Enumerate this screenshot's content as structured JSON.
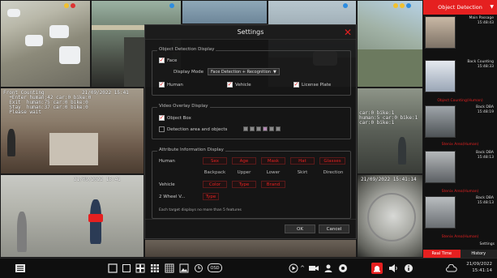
{
  "cameras": [
    {
      "id": "cam1",
      "timestamp": "",
      "overlay": "",
      "dots": []
    },
    {
      "id": "cam2",
      "timestamp": "",
      "overlay": "",
      "dots": []
    },
    {
      "id": "cam3",
      "timestamp": "",
      "overlay": "",
      "dots": []
    },
    {
      "id": "cam4",
      "timestamp": "",
      "overlay": "",
      "dots": []
    },
    {
      "id": "cam5",
      "timestamp": "",
      "overlay": "",
      "dots": []
    },
    {
      "id": "cam6",
      "timestamp": "",
      "overlay": "",
      "dots": []
    }
  ],
  "cam_overlays": {
    "cam1_ts": "",
    "cam6_ts": "Front Counting",
    "cam6_text": "  +Enter human:42 car:0 bike:0\n  Exit  human:75 car:0 bike:0\n  Stay  human:37 car:0 bike:0\n  Please wait",
    "cam6_date": "21/09/2022 15:41",
    "cam7_text": "car:0 bike:1\nhuman:5 car:0 bike:1\ncar:0 bike:1",
    "cam8_date": "21/09/2022 15:41",
    "cam10_date": "21/09/2022 15:41:14"
  },
  "right_panel": {
    "header": "Object Detection",
    "detections": [
      {
        "title": "Main Passage",
        "time": "15:48:43",
        "label": ""
      },
      {
        "title": "Back Counting",
        "time": "15:48:33",
        "label": "Object Counting(Human)"
      },
      {
        "title": "Back DBA",
        "time": "15:48:19",
        "label": "Stenix Area(Human)"
      },
      {
        "title": "Back DBA",
        "time": "15:48:13",
        "label": "Stenix Area(Human)"
      },
      {
        "title": "Back DBA",
        "time": "15:48:13",
        "label": "Stenix Area(Human)"
      }
    ],
    "settings_label": "Settings",
    "tab_realtime": "Real Time",
    "tab_history": "History"
  },
  "dialog": {
    "title": "Settings",
    "object_detection": {
      "section_title": "Object Detection Display",
      "face_label": "Face",
      "display_mode_label": "Display Mode",
      "display_mode_value": "Face Detection + Recognition",
      "human_label": "Human",
      "vehicle_label": "Vehicle",
      "plate_label": "License Plate"
    },
    "video_overlay": {
      "section_title": "Video Overlay Display",
      "object_box_label": "Object Box",
      "detection_area_label": "Detection area and objects",
      "swatch_colors": [
        "#8a8a8a",
        "#8a8a8a",
        "#8a8a8a",
        "#b48ab4",
        "#8a8a8a",
        "#8a8a8a"
      ]
    },
    "attribute": {
      "section_title": "Attribute Information Display",
      "human_label": "Human",
      "human_row1": [
        "Sex",
        "Age",
        "Mask",
        "Hat",
        "Glasses"
      ],
      "human_row2": [
        "Backpack",
        "Upper",
        "Lower",
        "Skirt",
        "Direction"
      ],
      "vehicle_label": "Vehicle",
      "vehicle_row": [
        "Color",
        "Type",
        "Brand"
      ],
      "two_wheel_label": "2 Wheel V...",
      "two_wheel_row": [
        "Type"
      ],
      "note": "Each target displays no more than 5 features"
    },
    "ok_label": "OK",
    "cancel_label": "Cancel"
  },
  "taskbar": {
    "osd_label": "OSD",
    "date": "21/09/2022",
    "time": "15:41:14"
  },
  "colors": {
    "accent": "#e52020"
  }
}
